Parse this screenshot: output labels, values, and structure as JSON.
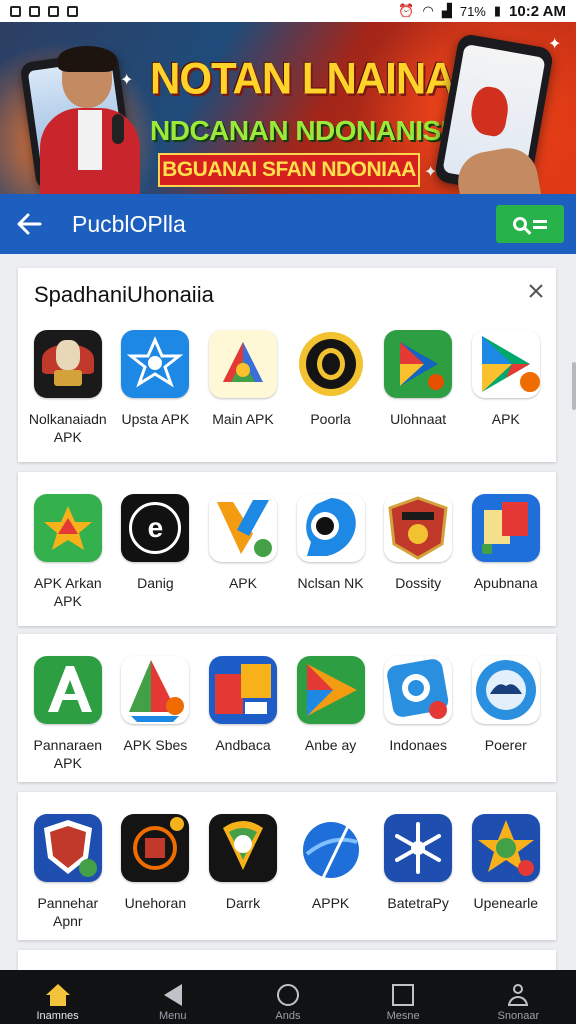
{
  "status_bar": {
    "battery_text": "71%",
    "time": "10:2 AM",
    "icons": [
      "gallery-icon",
      "notification-icon",
      "mail-icon",
      "photo-icon",
      "alarm-icon",
      "wifi-icon",
      "signal-icon",
      "battery-icon"
    ]
  },
  "banner": {
    "title_line1": "NOTAN LNAINAM",
    "title_line2": "NDCANAN NDONANISIA",
    "ribbon": "BGUANAI SFAN NDONIAA"
  },
  "app_bar": {
    "back_icon": "arrow-left-icon",
    "title": "PucblOPlla",
    "search_icon": "search-icon"
  },
  "cards": [
    {
      "title": "SpadhaniUhonaiia",
      "close_icon": "close-icon",
      "apps": [
        {
          "label": "Nolkanaiadn APK",
          "icon": "eagle-emblem-icon"
        },
        {
          "label": "Upsta APK",
          "icon": "star-shield-icon"
        },
        {
          "label": "Main APK",
          "icon": "chrome-apk-icon"
        },
        {
          "label": "Poorla",
          "icon": "gold-coin-icon"
        },
        {
          "label": "Ulohnaat",
          "icon": "play-green-icon"
        },
        {
          "label": "APK",
          "icon": "play-store-icon"
        }
      ]
    },
    {
      "title": "",
      "apps": [
        {
          "label": "APK Arkan APK",
          "icon": "star-fox-icon"
        },
        {
          "label": "Danig",
          "icon": "e-badge-icon"
        },
        {
          "label": "APK",
          "icon": "k-arrow-icon"
        },
        {
          "label": "Nclsan NK",
          "icon": "droplet-icon"
        },
        {
          "label": "Dossity",
          "icon": "crest-icon"
        },
        {
          "label": "Apubnana",
          "icon": "document-icon"
        }
      ]
    },
    {
      "title": "",
      "apps": [
        {
          "label": "Pannaraen APK",
          "icon": "a-letter-icon"
        },
        {
          "label": "APK Sbes",
          "icon": "sail-icon"
        },
        {
          "label": "Andbaca",
          "icon": "folders-icon"
        },
        {
          "label": "Anbe ay",
          "icon": "play-orange-icon"
        },
        {
          "label": "Indonaes",
          "icon": "camera-bubble-icon"
        },
        {
          "label": "Poerer",
          "icon": "gear-car-icon"
        }
      ]
    },
    {
      "title": "",
      "apps": [
        {
          "label": "Pannehar Apnr",
          "icon": "shield-flag-icon"
        },
        {
          "label": "Unehoran",
          "icon": "emblem-dark-icon"
        },
        {
          "label": "Darrk",
          "icon": "leaf-chat-icon"
        },
        {
          "label": "APPK",
          "icon": "globe-icon"
        },
        {
          "label": "BatetraPy",
          "icon": "snowflake-icon"
        },
        {
          "label": "Upenearle",
          "icon": "star-color-icon"
        }
      ]
    }
  ],
  "bottom_nav": [
    {
      "label": "Inamnes",
      "icon": "home-icon",
      "active": true
    },
    {
      "label": "Menu",
      "icon": "back-triangle-icon",
      "active": false
    },
    {
      "label": "Ands",
      "icon": "search-circle-icon",
      "active": false
    },
    {
      "label": "Mesne",
      "icon": "square-icon",
      "active": false
    },
    {
      "label": "Snonaar",
      "icon": "user-icon",
      "active": false
    }
  ],
  "colors": {
    "app_bar": "#1d5fbf",
    "search_button": "#27b34a",
    "banner_accent": "#e23a14",
    "nav_background": "#111214",
    "nav_active": "#f3c33c"
  }
}
